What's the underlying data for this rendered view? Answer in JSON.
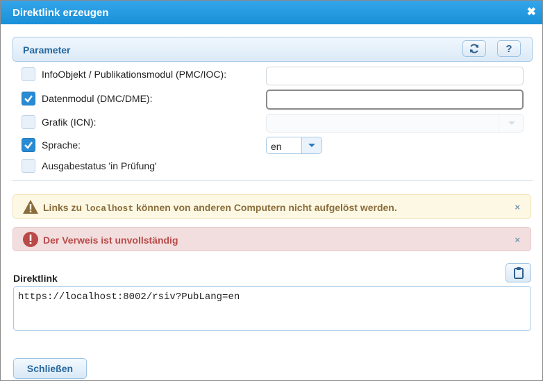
{
  "dialog": {
    "title": "Direktlink erzeugen"
  },
  "panel": {
    "title": "Parameter",
    "help_label": "?"
  },
  "options": [
    {
      "label": "InfoObjekt / Publikationsmodul (PMC/IOC):",
      "checked": false
    },
    {
      "label": "Datenmodul (DMC/DME):",
      "checked": true
    },
    {
      "label": "Grafik (ICN):",
      "checked": false
    },
    {
      "label": "Sprache:",
      "checked": true
    },
    {
      "label": "Ausgabestatus 'in Prüfung'",
      "checked": false
    }
  ],
  "fields": {
    "pmc_value": "",
    "dmc_value": "",
    "icn_value": "",
    "language": "en"
  },
  "alerts": {
    "warning": {
      "before": "Links zu ",
      "code": "localhost",
      "after": " können von anderen Computern nicht aufgelöst werden.",
      "close": "×"
    },
    "error": {
      "text": "Der Verweis ist unvollständig",
      "close": "×"
    }
  },
  "direktlink": {
    "label": "Direktlink",
    "value": "https://localhost:8002/rsiv?PubLang=en"
  },
  "footer": {
    "close_label": "Schließen"
  },
  "colors": {
    "titlebar": "#1990d8",
    "accent": "#2a8ad4",
    "warning_bg": "#fcf8e3",
    "error_bg": "#f2dede"
  },
  "icons": {
    "title_close": "close-icon",
    "refresh": "refresh-icon",
    "help": "help-icon",
    "warning": "warning-icon",
    "error": "error-icon",
    "copy": "clipboard-icon"
  }
}
